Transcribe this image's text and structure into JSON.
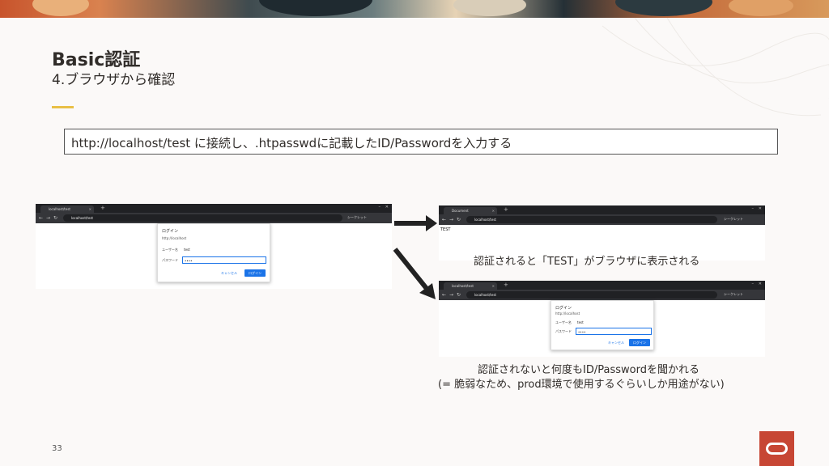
{
  "slide": {
    "title": "Basic認証",
    "subtitle": "4.ブラウザから確認",
    "instruction": "http://localhost/test  に接続し、.htpasswdに記載したID/Passwordを入力する",
    "page_number": "33",
    "accent_color": "#e9c046",
    "logo_color": "#c74634"
  },
  "browser_left": {
    "tab_title": "localhost/test",
    "address": "localhost/test",
    "incognito_label": "シークレット",
    "dialog": {
      "title": "ログイン",
      "host": "http://localhost",
      "username_label": "ユーザー名",
      "username_value": "test",
      "password_label": "パスワード",
      "password_value": "••••",
      "cancel_label": "キャンセル",
      "login_label": "ログイン"
    }
  },
  "browser_success": {
    "tab_title": "Document",
    "address": "localhost/test",
    "incognito_label": "シークレット",
    "page_text": "TEST"
  },
  "browser_fail": {
    "tab_title": "localhost/test",
    "address": "localhost/test",
    "incognito_label": "シークレット",
    "dialog": {
      "title": "ログイン",
      "host": "http://localhost",
      "username_label": "ユーザー名",
      "username_value": "test",
      "password_label": "パスワード",
      "password_value": "••••",
      "cancel_label": "キャンセル",
      "login_label": "ログイン"
    }
  },
  "captions": {
    "success": "認証されると「TEST」がブラウザに表示される",
    "fail_line1": "認証されないと何度もID/Passwordを聞かれる",
    "fail_line2": "(= 脆弱なため、prod環境で使用するぐらいしか用途がない)"
  },
  "icons": [
    "arrow-right-icon",
    "arrow-down-right-icon",
    "oracle-logo-icon"
  ]
}
